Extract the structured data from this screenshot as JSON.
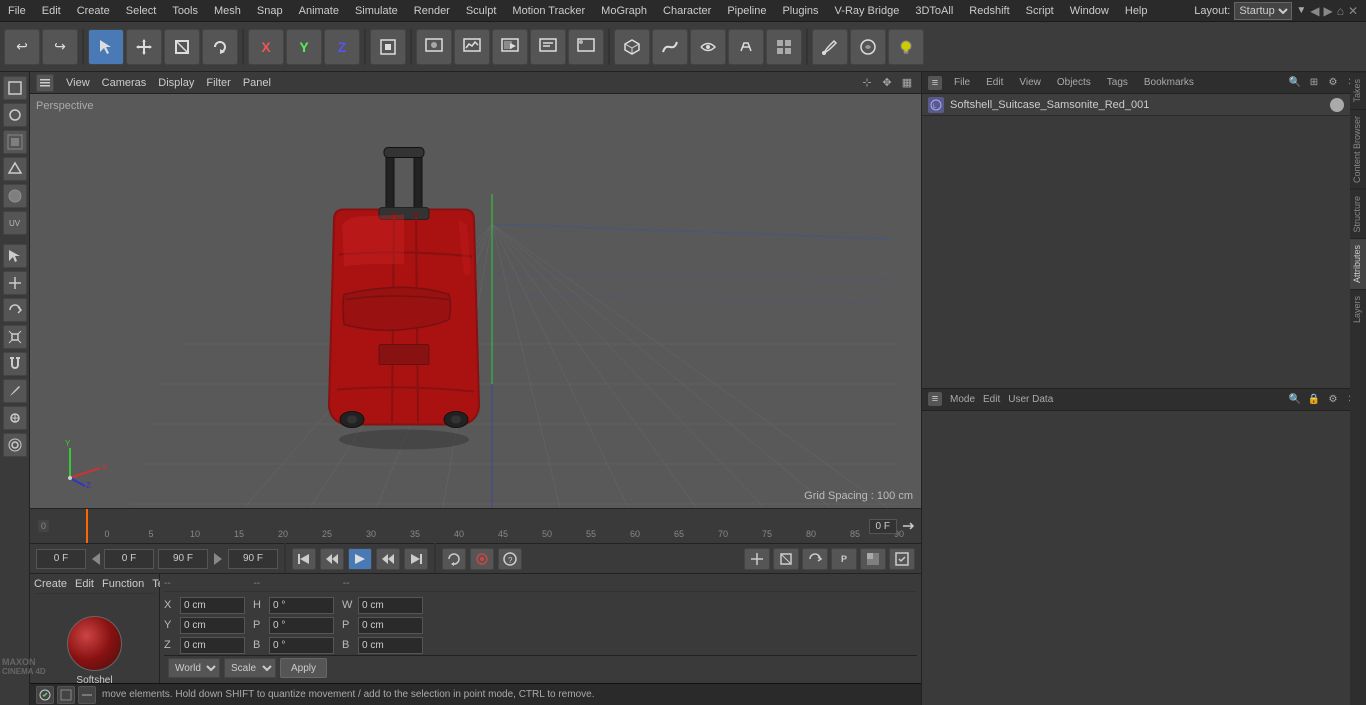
{
  "app": {
    "title": "Cinema 4D"
  },
  "menu": {
    "items": [
      "File",
      "Edit",
      "Create",
      "Select",
      "Tools",
      "Mesh",
      "Snap",
      "Animate",
      "Simulate",
      "Render",
      "Sculpt",
      "Motion Tracker",
      "MoGraph",
      "Character",
      "Pipeline",
      "Plugins",
      "V-Ray Bridge",
      "3DToAll",
      "Redshift",
      "Script",
      "Window",
      "Help"
    ],
    "layout_label": "Layout:",
    "layout_value": "Startup"
  },
  "toolbar": {
    "undo_icon": "↩",
    "redo_icon": "↪",
    "select_icon": "↖",
    "move_icon": "✥",
    "scale_icon": "⊞",
    "rotate_icon": "↻",
    "x_axis": "X",
    "y_axis": "Y",
    "z_axis": "Z",
    "cube_icon": "■",
    "pyramid_icon": "▲",
    "sphere_icon": "●",
    "camera_icon": "📷",
    "light_icon": "☀",
    "frame_icons": [
      "▣",
      "▤",
      "▦",
      "▥",
      "▧"
    ],
    "spline_icon": "∿",
    "nurbs_icon": "⋈",
    "deform_icon": "⌀",
    "array_icon": "⊞",
    "paint_icon": "◆",
    "bend_icon": "⌒",
    "model_icon": "⬡",
    "joints_icon": "⬗"
  },
  "viewport": {
    "label": "Perspective",
    "menu_items": [
      "View",
      "Cameras",
      "Display",
      "Filter",
      "Panel"
    ],
    "grid_spacing": "Grid Spacing : 100 cm"
  },
  "scene": {
    "object_name": "Softshell_Suitcase_Samsonite_Red_001",
    "object_type_icon": "L◎"
  },
  "timeline": {
    "markers": [
      "0",
      "5",
      "10",
      "15",
      "20",
      "25",
      "30",
      "35",
      "40",
      "45",
      "50",
      "55",
      "60",
      "65",
      "70",
      "75",
      "80",
      "85",
      "90"
    ],
    "current_frame": "0 F",
    "start_frame": "0 F",
    "end_frame": "90 F",
    "preview_end": "90 F"
  },
  "playback": {
    "buttons": [
      "⏮",
      "◀◀",
      "▶",
      "▶▶",
      "⏭"
    ],
    "frame_field": "0 F",
    "end_frame": "90 F"
  },
  "coordinates": {
    "pos_label": "--",
    "rot_label": "--",
    "x_pos": "0 cm",
    "y_pos": "0 cm",
    "z_pos": "0 cm",
    "h_rot": "0 °",
    "p_rot": "0 °",
    "b_rot": "0 °",
    "x_size": "0 cm",
    "y_size": "0 cm",
    "z_size": "0 cm",
    "w_label": "W",
    "p_label": "P",
    "b_label_size": "B",
    "world_label": "World",
    "scale_label": "Scale",
    "apply_label": "Apply"
  },
  "material": {
    "name": "Softshel"
  },
  "material_menu": {
    "create": "Create",
    "edit": "Edit",
    "function": "Function",
    "texture": "Texture"
  },
  "right_panel": {
    "tabs": [
      "File",
      "Edit",
      "View",
      "Objects",
      "Tags",
      "Bookmarks"
    ],
    "attr_tabs": [
      "Mode",
      "Edit",
      "User Data"
    ],
    "side_tabs": [
      "Takes",
      "Content Browser",
      "Structure",
      "Attributes",
      "Layers"
    ]
  },
  "status_bar": {
    "text": "move elements. Hold down SHIFT to quantize movement / add to the selection in point mode, CTRL to remove."
  },
  "extra_play_icons": [
    "⊞",
    "⊠",
    "↻",
    "P",
    "▦",
    "▣"
  ]
}
